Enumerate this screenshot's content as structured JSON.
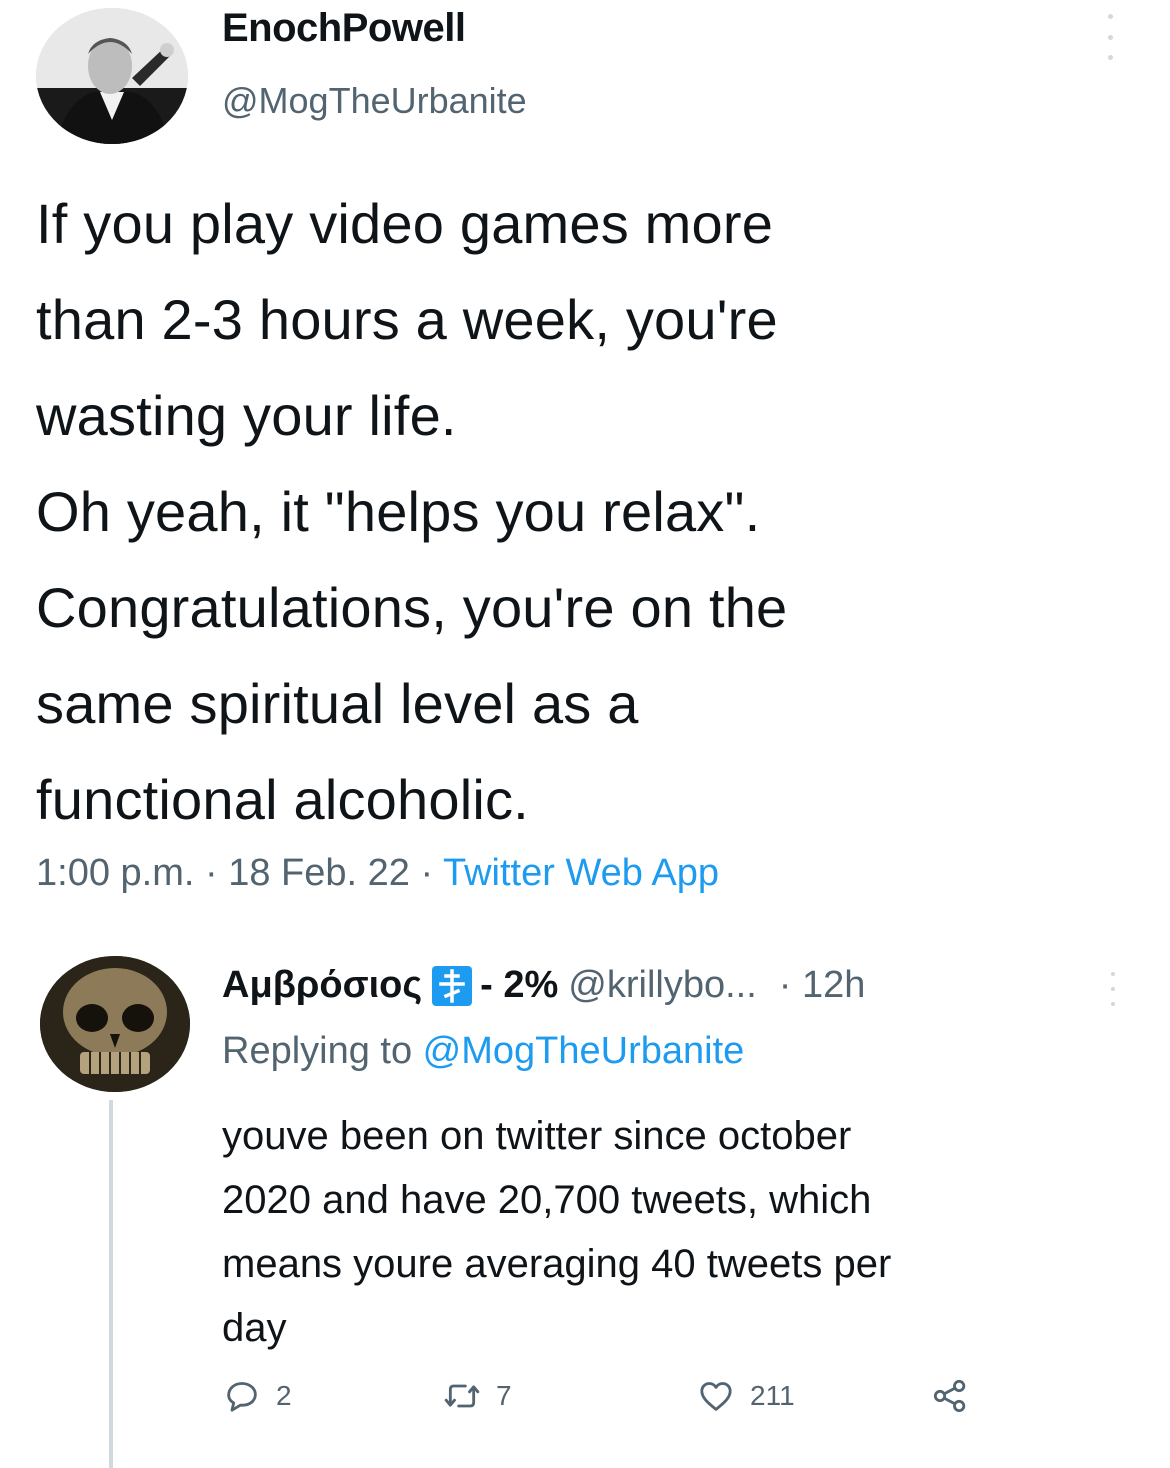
{
  "tweet": {
    "author_name": "EnochPowell",
    "author_handle": "@MogTheUrbanite",
    "lines": [
      "If you play video games more",
      "than 2-3 hours a week, you're",
      "wasting your life.",
      "Oh yeah, it \"helps you relax\".",
      "Congratulations, you're on the",
      "same spiritual level as a",
      "functional alcoholic."
    ],
    "time": "1:00 p.m.",
    "separator": " · ",
    "date": "18 Feb. 22",
    "source": "Twitter Web App"
  },
  "reply": {
    "author_name": "Αμβρόσιος",
    "badge_icon": "orthodox-cross-icon",
    "percent_tag": "- 2%",
    "author_handle": "@krillybo...",
    "time": "· 12h",
    "replying_prefix": "Replying to ",
    "replying_to": "@MogTheUrbanite",
    "lines": [
      "youve been on twitter since october",
      "2020 and have 20,700 tweets, which",
      "means youre averaging 40 tweets per",
      "day"
    ],
    "stats": {
      "replies": "2",
      "retweets": "7",
      "likes": "211"
    }
  },
  "colors": {
    "link": "#1d9bf0",
    "secondary": "#536471",
    "text": "#0f1419"
  }
}
